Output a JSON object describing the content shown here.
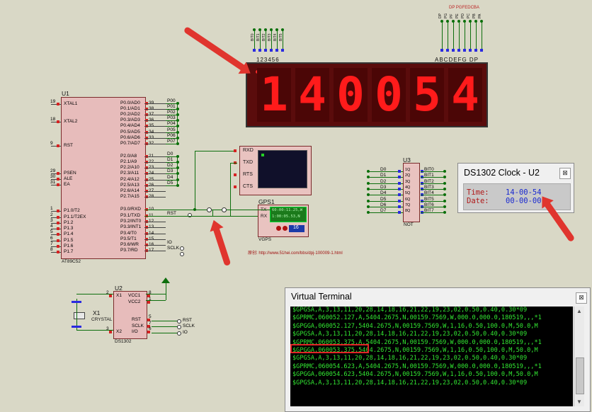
{
  "u1": {
    "ref": "U1",
    "part": "AT89C52",
    "left_pins": [
      {
        "num": "19",
        "name": "XTAL1"
      },
      {
        "num": "18",
        "name": "XTAL2"
      },
      {
        "num": "9",
        "name": "RST"
      },
      {
        "num": "29",
        "name": "PSEN"
      },
      {
        "num": "30",
        "name": "ALE"
      },
      {
        "num": "31",
        "name": "EA"
      },
      {
        "num": "1",
        "name": "P1.0/T2"
      },
      {
        "num": "2",
        "name": "P1.1/T2EX"
      },
      {
        "num": "3",
        "name": "P1.2"
      },
      {
        "num": "4",
        "name": "P1.3"
      },
      {
        "num": "5",
        "name": "P1.4"
      },
      {
        "num": "6",
        "name": "P1.5"
      },
      {
        "num": "7",
        "name": "P1.6"
      },
      {
        "num": "8",
        "name": "P1.7"
      }
    ],
    "right_p0": [
      {
        "num": "39",
        "name": "P0.0/AD0",
        "net": "P00"
      },
      {
        "num": "38",
        "name": "P0.1/AD1",
        "net": "P01"
      },
      {
        "num": "37",
        "name": "P0.2/AD2",
        "net": "P02"
      },
      {
        "num": "36",
        "name": "P0.3/AD3",
        "net": "P03"
      },
      {
        "num": "35",
        "name": "P0.4/AD4",
        "net": "P04"
      },
      {
        "num": "34",
        "name": "P0.5/AD5",
        "net": "P05"
      },
      {
        "num": "33",
        "name": "P0.6/AD6",
        "net": "P06"
      },
      {
        "num": "32",
        "name": "P0.7/AD7",
        "net": "P07"
      }
    ],
    "right_p2": [
      {
        "num": "21",
        "name": "P2.0/A8",
        "net": "D0"
      },
      {
        "num": "22",
        "name": "P2.1/A9",
        "net": "D1"
      },
      {
        "num": "23",
        "name": "P2.2/A10",
        "net": "D2"
      },
      {
        "num": "24",
        "name": "P2.3/A11",
        "net": "D3"
      },
      {
        "num": "25",
        "name": "P2.4/A12",
        "net": "D4"
      },
      {
        "num": "26",
        "name": "P2.5/A13",
        "net": "D5"
      },
      {
        "num": "27",
        "name": "P2.6/A14",
        "net": ""
      },
      {
        "num": "28",
        "name": "P2.7/A15",
        "net": ""
      }
    ],
    "right_p3": [
      {
        "num": "10",
        "name": "P3.0/RXD",
        "net": ""
      },
      {
        "num": "11",
        "name": "P3.1/TXD",
        "net": "RST"
      },
      {
        "num": "12",
        "name": "P3.2/INT0",
        "net": ""
      },
      {
        "num": "13",
        "name": "P3.3/INT1",
        "net": ""
      },
      {
        "num": "14",
        "name": "P3.4/T0",
        "net": ""
      },
      {
        "num": "15",
        "name": "P3.5/T1",
        "net": ""
      },
      {
        "num": "16",
        "name": "P3.6/WR",
        "net": "IO"
      },
      {
        "num": "17",
        "name": "P3.7/RD",
        "net": "SCLK"
      }
    ]
  },
  "u2": {
    "ref": "U2",
    "part": "DS1302",
    "pins": [
      {
        "num": "2",
        "name": "X1"
      },
      {
        "num": "3",
        "name": "X2"
      },
      {
        "num": "8",
        "name": "VCC1"
      },
      {
        "num": "1",
        "name": "VCC2"
      },
      {
        "num": "5",
        "name": "RST"
      },
      {
        "num": "7",
        "name": "SCLK"
      },
      {
        "num": "6",
        "name": "I/O"
      }
    ],
    "nets": [
      "RST",
      "SCLK",
      "IO"
    ]
  },
  "x1": {
    "ref": "X1",
    "part": "CRYSTAL"
  },
  "display": {
    "digits": [
      "1",
      "4",
      "0",
      "0",
      "5",
      "4"
    ],
    "top_left_label": "123456",
    "top_right_label": "ABCDEFG DP",
    "bit_labels": [
      "BIT0",
      "BIT1",
      "BIT2",
      "BIT3",
      "BIT4",
      "BIT5"
    ],
    "seg_labels": [
      "DP",
      "PG",
      "PF",
      "PE",
      "PD",
      "PC",
      "PB",
      "PA"
    ],
    "seg_header": "DP PGFEDCBA"
  },
  "u3": {
    "ref": "U3",
    "part": "NOT",
    "inputs": [
      "D0",
      "D1",
      "D2",
      "D3",
      "D4",
      "D5",
      "D6",
      "D7"
    ],
    "outputs": [
      "BIT0",
      "BIT1",
      "BIT2",
      "BIT3",
      "BIT4",
      "BIT5",
      "BIT6",
      "BIT7"
    ],
    "pin_labels": [
      "1Q",
      "2Q",
      "3Q",
      "4Q",
      "5Q",
      "6Q",
      "7Q",
      "8Q"
    ]
  },
  "uart_box": {
    "pins": [
      "RXD",
      "TXD",
      "RTS",
      "CTS"
    ]
  },
  "gps": {
    "ref": "GPS1",
    "part": "VGPS",
    "pins": [
      "TX",
      "RX"
    ],
    "lcd1": "60:00:11.25,W",
    "lcd2": "1:00:05.53,N",
    "lcd3": "16"
  },
  "source_text": "原创: http://www.51hei.com/bbs/dpj-100009-1.html",
  "popup": {
    "title": "DS1302 Clock - U2",
    "time_label": "Time:",
    "time_value": "14-00-54",
    "date_label": "Date:",
    "date_value": "00-00-00",
    "close": "⊠"
  },
  "terminal": {
    "title": "Virtual Terminal",
    "close": "⊠",
    "lines": [
      "$GPGSA,A,3,13,11,20,28,14,18,16,21,22,19,23,02,0.50,0.40,0.30*09",
      "$GPRMC,060052.127,A,5404.2675,N,00159.7569,W,000.0,000.0,180519,,,*1",
      "$GPGGA,060052.127,5404.2675,N,00159.7569,W,1,16,0.50,100.0,M,50.0,M",
      "$GPGSA,A,3,13,11,20,28,14,18,16,21,22,19,23,02,0.50,0.40,0.30*09",
      "$GPRMC,060053.375,A,5404.2675,N,00159.7569,W,000.0,000.0,180519,,,*1",
      "$GPGGA,060053.375,5404.2675,N,00159.7569,W,1,16,0.50,100.0,M,50.0,M",
      "$GPGSA,A,3,13,11,20,28,14,18,16,21,22,19,23,02,0.50,0.40,0.30*09",
      "$GPRMC,060054.623,A,5404.2675,N,00159.7569,W,000.0,000.0,180519,,,*1",
      "$GPGGA,060054.623,5404.2675,N,00159.7569,W,1,16,0.50,100.0,M,50.0,M",
      "$GPGSA,A,3,13,11,20,28,14,18,16,21,22,19,23,02,0.50,0.40,0.30*09"
    ],
    "highlight": "$GPRMC,060053.375,"
  },
  "colors": {
    "background": "#d9d8c6",
    "wire": "#0d6e0d",
    "segment": "#ff1b1b",
    "terminal_text": "#32e632",
    "arrow": "#e0352e"
  }
}
